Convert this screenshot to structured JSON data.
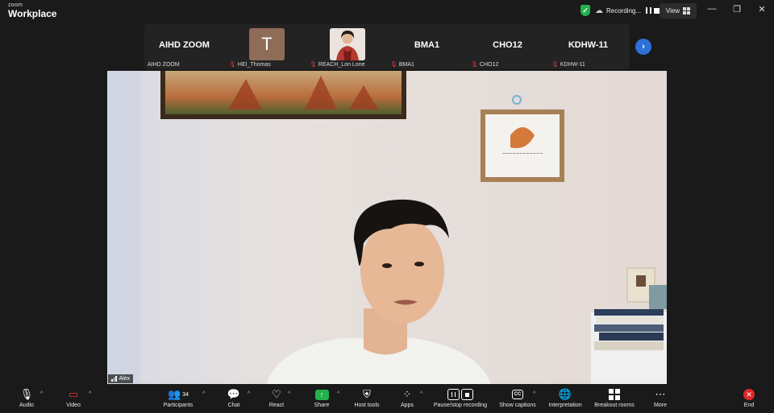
{
  "app": {
    "brand_top": "zoom",
    "brand_bottom": "Workplace"
  },
  "titlebar": {
    "recording_label": "Recording...",
    "view_label": "View",
    "minimize_icon": "minimize-icon",
    "restore_icon": "restore-icon",
    "close_icon": "close-icon"
  },
  "participants_strip": {
    "tiles": [
      {
        "display": "AIHD ZOOM",
        "label": "AIHD ZOOM",
        "muted": false
      },
      {
        "display": "T",
        "label": "HEI_Thomas",
        "muted": true
      },
      {
        "display": "",
        "label": "REACH_Lon Lone",
        "muted": true
      },
      {
        "display": "BMA1",
        "label": "BMA1",
        "muted": true
      },
      {
        "display": "CHO12",
        "label": "CHO12",
        "muted": true
      },
      {
        "display": "KDHW-11",
        "label": "KDHW-11",
        "muted": true
      }
    ]
  },
  "main_video": {
    "name": "Alex"
  },
  "toolbar": {
    "audio": "Audio",
    "video": "Video",
    "participants": "Participants",
    "participants_count": "34",
    "chat": "Chat",
    "react": "React",
    "share": "Share",
    "host_tools": "Host tools",
    "apps": "Apps",
    "pause_stop_recording": "Pause/stop recording",
    "show_captions": "Show captions",
    "cc_text": "CC",
    "interpretation": "Interpretation",
    "breakout_rooms": "Breakout rooms",
    "more": "More",
    "end": "End"
  },
  "colors": {
    "accent": "#2e6fd8",
    "share_green": "#22b14c",
    "end_red": "#e02828",
    "muted_red": "#e23b3b"
  }
}
